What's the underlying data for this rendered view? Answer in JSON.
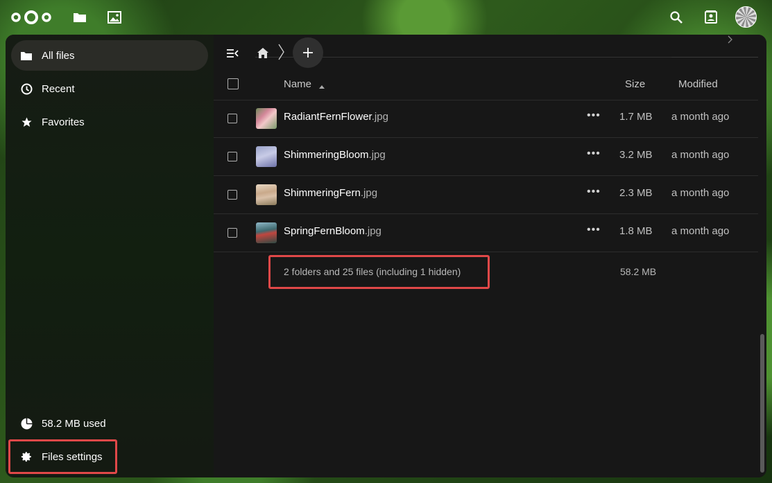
{
  "header": {
    "logo": "nextcloud-logo",
    "apps": [
      "files-icon",
      "photos-icon"
    ],
    "right_icons": [
      "search-icon",
      "contacts-icon"
    ]
  },
  "sidebar": {
    "items": [
      {
        "label": "All files",
        "icon": "folder-icon"
      },
      {
        "label": "Recent",
        "icon": "clock-icon"
      },
      {
        "label": "Favorites",
        "icon": "star-icon"
      }
    ],
    "storage": "58.2 MB used",
    "settings": "Files settings"
  },
  "files": {
    "columns": {
      "name": "Name",
      "size": "Size",
      "modified": "Modified"
    },
    "rows": [
      {
        "name": "RadiantFernFlower",
        "ext": ".jpg",
        "size": "1.7 MB",
        "modified": "a month ago"
      },
      {
        "name": "ShimmeringBloom",
        "ext": ".jpg",
        "size": "3.2 MB",
        "modified": "a month ago"
      },
      {
        "name": "ShimmeringFern",
        "ext": ".jpg",
        "size": "2.3 MB",
        "modified": "a month ago"
      },
      {
        "name": "SpringFernBloom",
        "ext": ".jpg",
        "size": "1.8 MB",
        "modified": "a month ago"
      }
    ],
    "summary": "2 folders and 25 files (including 1 hidden)",
    "summary_size": "58.2 MB",
    "more_label": "•••"
  },
  "colors": {
    "highlight": "#e04848",
    "panel": "#171717",
    "active_nav": "#2b2c27"
  }
}
